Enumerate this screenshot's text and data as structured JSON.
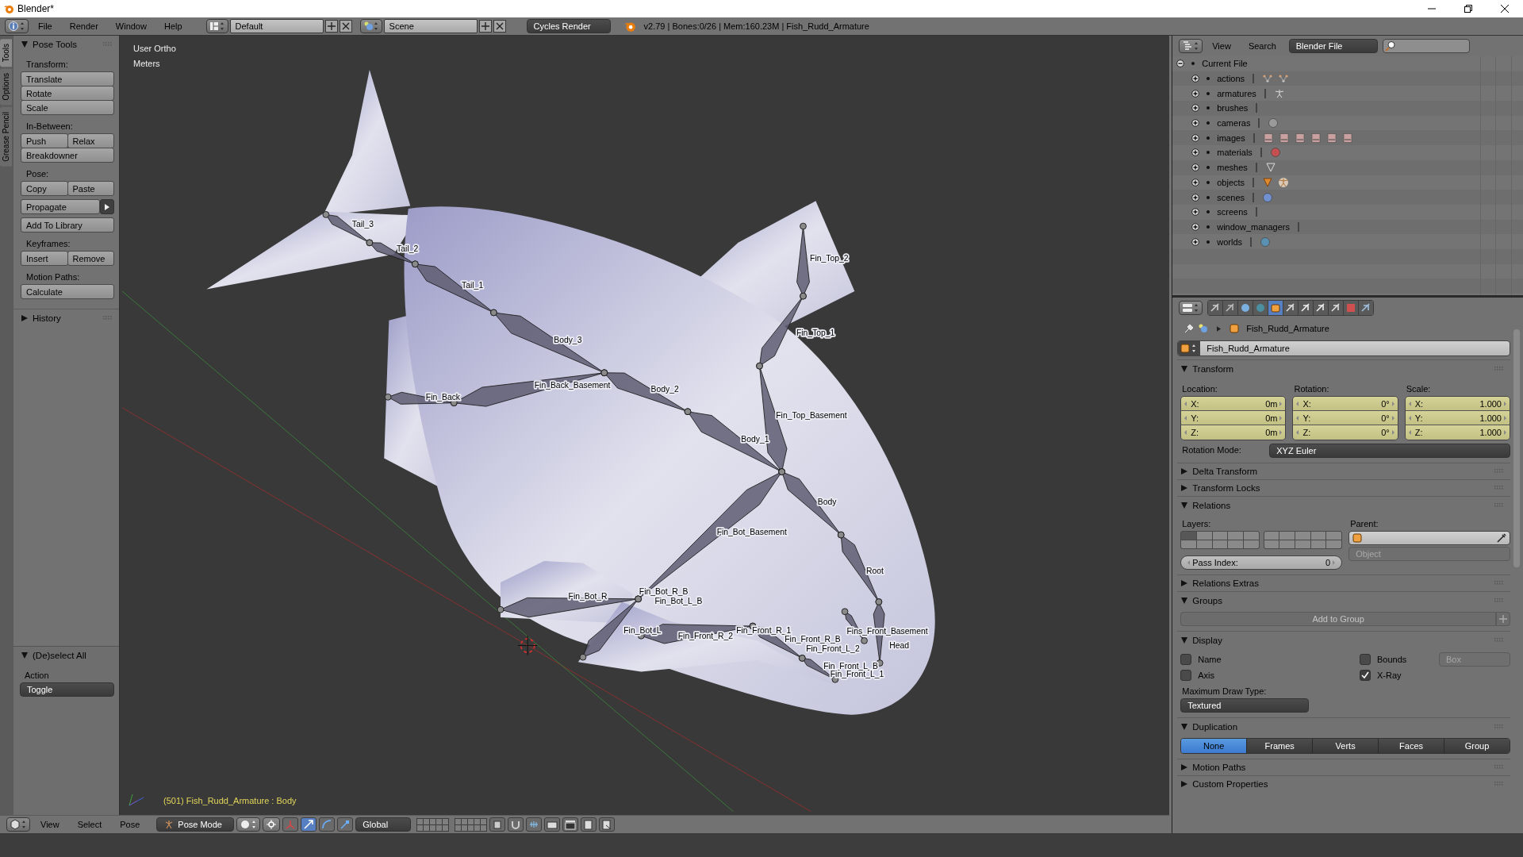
{
  "window": {
    "title": "Blender*"
  },
  "info_bar": {
    "menus": [
      "File",
      "Render",
      "Window",
      "Help"
    ],
    "layout": "Default",
    "scene": "Scene",
    "engine": "Cycles Render",
    "stats": "v2.79 | Bones:0/26 | Mem:160.23M | Fish_Rudd_Armature"
  },
  "tool_tabs": [
    {
      "label": "Tools",
      "selected": true
    },
    {
      "label": "Options",
      "selected": false
    },
    {
      "label": "Grease Pencil",
      "selected": false
    }
  ],
  "tool_panel": {
    "title": "Pose Tools",
    "expanded": true,
    "groups": [
      {
        "label": "Transform:",
        "rows": [
          {
            "kind": "buttons",
            "buttons": [
              "Translate"
            ]
          },
          {
            "kind": "buttons",
            "buttons": [
              "Rotate"
            ]
          },
          {
            "kind": "buttons",
            "buttons": [
              "Scale"
            ]
          }
        ]
      },
      {
        "label": "In-Between:",
        "rows": [
          {
            "kind": "buttons",
            "buttons": [
              "Push",
              "Relax"
            ]
          },
          {
            "kind": "buttons",
            "buttons": [
              "Breakdowner"
            ]
          }
        ]
      },
      {
        "label": "Pose:",
        "rows": [
          {
            "kind": "buttons",
            "buttons": [
              "Copy",
              "Paste"
            ]
          },
          {
            "kind": "menu",
            "buttons": [
              "Propagate"
            ]
          },
          {
            "kind": "buttons",
            "buttons": [
              "Add To Library"
            ]
          }
        ]
      },
      {
        "label": "Keyframes:",
        "rows": [
          {
            "kind": "buttons",
            "buttons": [
              "Insert",
              "Remove"
            ]
          }
        ]
      },
      {
        "label": "Motion Paths:",
        "rows": [
          {
            "kind": "buttons",
            "buttons": [
              "Calculate"
            ]
          }
        ]
      }
    ]
  },
  "history": {
    "title": "History",
    "expanded": false
  },
  "operator_panel": {
    "title": "(De)select All",
    "expanded": true,
    "label": "Action",
    "value": "Toggle"
  },
  "viewport": {
    "view_name": "User Ortho",
    "units": "Meters",
    "status": "(501) Fish_Rudd_Armature : Body",
    "bones": [
      "Tail_3",
      "Tail_2",
      "Tail_1",
      "Body_3",
      "Fin_Back_Basement",
      "Fin_Back",
      "Body_2",
      "Fin_Top_2",
      "Fin_Top_1",
      "Fin_Top_Basement",
      "Body_1",
      "Body",
      "Fin_Bot_Basement",
      "Root",
      "Fins_Front_Basement",
      "Head",
      "Fin_Bot_R",
      "Fin_Bot_R_B",
      "Fin_Bot_L_B",
      "Fin_Bot_L",
      "Fin_Front_R_2",
      "Fin_Front_R_1",
      "Fin_Front_R_B",
      "Fin_Front_L_2",
      "Fin_Front_L_B",
      "Fin_Front_L_1"
    ]
  },
  "viewport_header": {
    "menus": [
      "View",
      "Select",
      "Pose"
    ],
    "mode": "Pose Mode",
    "orientation": "Global"
  },
  "outliner": {
    "menus": [
      "View",
      "Search"
    ],
    "display": "Blender File",
    "root": {
      "label": "Current File",
      "expanded": true,
      "children": [
        {
          "label": "actions",
          "expanded": false
        },
        {
          "label": "armatures",
          "expanded": false
        },
        {
          "label": "brushes",
          "expanded": false
        },
        {
          "label": "cameras",
          "expanded": false
        },
        {
          "label": "images",
          "expanded": false
        },
        {
          "label": "materials",
          "expanded": false
        },
        {
          "label": "meshes",
          "expanded": false
        },
        {
          "label": "objects",
          "expanded": false
        },
        {
          "label": "scenes",
          "expanded": false
        },
        {
          "label": "screens",
          "expanded": false
        },
        {
          "label": "window_managers",
          "expanded": false
        },
        {
          "label": "worlds",
          "expanded": false
        }
      ]
    }
  },
  "properties": {
    "tabs": [
      {
        "kind": "render",
        "selected": false
      },
      {
        "kind": "layers",
        "selected": false
      },
      {
        "kind": "scene",
        "selected": false
      },
      {
        "kind": "world",
        "selected": false
      },
      {
        "kind": "object",
        "selected": true
      },
      {
        "kind": "constraints",
        "selected": false
      },
      {
        "kind": "armature",
        "selected": false
      },
      {
        "kind": "bone",
        "selected": false
      },
      {
        "kind": "bone-constraints",
        "selected": false
      },
      {
        "kind": "texture",
        "selected": false
      },
      {
        "kind": "brush",
        "selected": false
      }
    ],
    "breadcrumb": "Fish_Rudd_Armature",
    "name": "Fish_Rudd_Armature",
    "panels": [
      {
        "kind": "transform",
        "title": "Transform",
        "expanded": true,
        "columns": [
          {
            "label": "Location:",
            "fields": [
              {
                "axis": "X:",
                "value": "0m"
              },
              {
                "axis": "Y:",
                "value": "0m"
              },
              {
                "axis": "Z:",
                "value": "0m"
              }
            ]
          },
          {
            "label": "Rotation:",
            "fields": [
              {
                "axis": "X:",
                "value": "0°"
              },
              {
                "axis": "Y:",
                "value": "0°"
              },
              {
                "axis": "Z:",
                "value": "0°"
              }
            ]
          },
          {
            "label": "Scale:",
            "fields": [
              {
                "axis": "X:",
                "value": "1.000"
              },
              {
                "axis": "Y:",
                "value": "1.000"
              },
              {
                "axis": "Z:",
                "value": "1.000"
              }
            ]
          }
        ],
        "rotation_mode": {
          "label": "Rotation Mode:",
          "value": "XYZ Euler"
        }
      },
      {
        "kind": "plain",
        "title": "Delta Transform",
        "expanded": false
      },
      {
        "kind": "plain",
        "title": "Transform Locks",
        "expanded": false
      },
      {
        "kind": "relations",
        "title": "Relations",
        "expanded": true,
        "layers_label": "Layers:",
        "layers": [
          {
            "on": true
          },
          {
            "on": false
          },
          {
            "on": false
          },
          {
            "on": false
          },
          {
            "on": false
          },
          {
            "on": false
          },
          {
            "on": false
          },
          {
            "on": false
          },
          {
            "on": false
          },
          {
            "on": false
          },
          {
            "on": false
          },
          {
            "on": false
          },
          {
            "on": false
          },
          {
            "on": false
          },
          {
            "on": false
          },
          {
            "on": false
          },
          {
            "on": false
          },
          {
            "on": false
          },
          {
            "on": false
          },
          {
            "on": false
          }
        ],
        "parent_label": "Parent:",
        "parent_type": "Object",
        "pass_index": {
          "label": "Pass Index:",
          "value": "0"
        }
      },
      {
        "kind": "plain",
        "title": "Relations Extras",
        "expanded": false
      },
      {
        "kind": "groups",
        "title": "Groups",
        "expanded": true,
        "button": "Add to Group"
      },
      {
        "kind": "display",
        "title": "Display",
        "expanded": true,
        "checks": [
          {
            "label": "Name",
            "checked": false
          },
          {
            "label": "Bounds",
            "checked": false
          },
          {
            "label": "Axis",
            "checked": false
          },
          {
            "label": "X-Ray",
            "checked": true
          }
        ],
        "bounds_type": "Box",
        "draw_type_label": "Maximum Draw Type:",
        "draw_type": "Textured"
      },
      {
        "kind": "duplication",
        "title": "Duplication",
        "expanded": true,
        "options": [
          {
            "label": "None",
            "selected": true
          },
          {
            "label": "Frames",
            "selected": false
          },
          {
            "label": "Verts",
            "selected": false
          },
          {
            "label": "Faces",
            "selected": false
          },
          {
            "label": "Group",
            "selected": false
          }
        ]
      },
      {
        "kind": "plain",
        "title": "Motion Paths",
        "expanded": false
      },
      {
        "kind": "plain",
        "title": "Custom Properties",
        "expanded": false
      }
    ]
  }
}
